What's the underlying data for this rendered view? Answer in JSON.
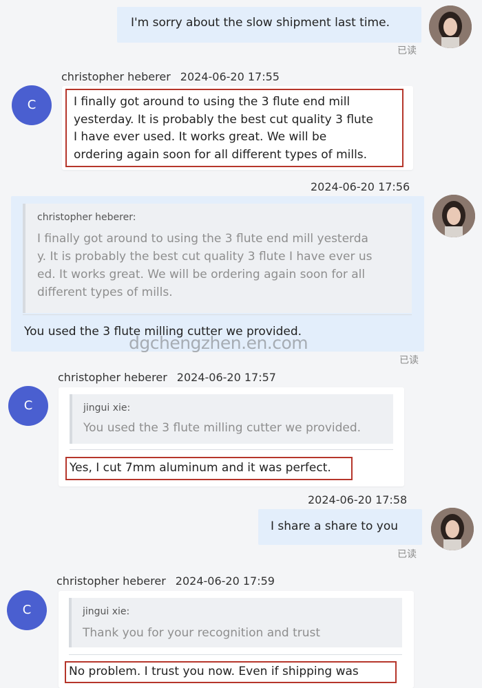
{
  "avatar_letter": "C",
  "read_label": "已读",
  "watermark": "dgchengzhen.en.com",
  "messages": {
    "m1": {
      "text": "I'm sorry about the slow shipment last time."
    },
    "m2": {
      "sender": "christopher heberer",
      "timestamp": "2024-06-20 17:55",
      "lines": [
        "I finally got around to using the 3 flute end mill",
        "yesterday. It is probably the best cut quality 3 flute",
        "I have ever used. It works great. We will be",
        "ordering again soon for all different types of mills."
      ]
    },
    "m3": {
      "timestamp": "2024-06-20 17:56",
      "quote_name": "christopher heberer:",
      "quote_lines": [
        "I finally got around to using the 3 flute end mill yesterda",
        "y. It is probably the best cut quality 3 flute I have ever us",
        "ed. It works great. We will be ordering again soon for all",
        "different types of mills."
      ],
      "reply": "You used the 3 flute milling cutter we provided."
    },
    "m4": {
      "sender": "christopher heberer",
      "timestamp": "2024-06-20 17:57",
      "quote_name": "jingui xie:",
      "quote_text": "You used the 3 flute milling cutter we provided.",
      "reply": "Yes, I cut 7mm aluminum and it was perfect."
    },
    "m5": {
      "timestamp": "2024-06-20 17:58",
      "text": "I share a share to you"
    },
    "m6": {
      "sender": "christopher heberer",
      "timestamp": "2024-06-20 17:59",
      "quote_name": "jingui xie:",
      "quote_text": "Thank you for your recognition and trust",
      "reply": "No problem. I trust you now. Even if shipping was"
    }
  }
}
